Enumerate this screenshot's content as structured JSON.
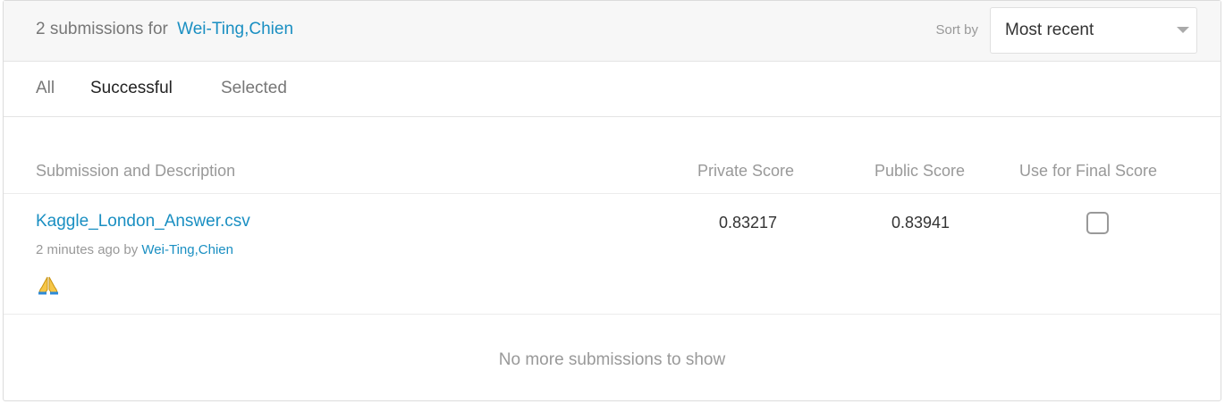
{
  "header": {
    "title_prefix": "2 submissions for",
    "user_name": "Wei-Ting,Chien",
    "sort_label": "Sort by",
    "sort_value": "Most recent"
  },
  "tabs": [
    {
      "label": "All",
      "active": false
    },
    {
      "label": "Successful",
      "active": true
    },
    {
      "label": "Selected",
      "active": false
    }
  ],
  "columns": {
    "submission": "Submission and Description",
    "private_score": "Private Score",
    "public_score": "Public Score",
    "final_score": "Use for Final Score"
  },
  "submissions": [
    {
      "file_name": "Kaggle_London_Answer.csv",
      "time_ago": "2 minutes ago by",
      "author": "Wei-Ting,Chien",
      "description_icon": "folded-hands-emoji",
      "private_score": "0.83217",
      "public_score": "0.83941",
      "use_for_final": false
    }
  ],
  "footer": {
    "no_more": "No more submissions to show"
  },
  "colors": {
    "link": "#1a8fc2",
    "muted": "#999999",
    "header_bg": "#f7f7f7"
  }
}
